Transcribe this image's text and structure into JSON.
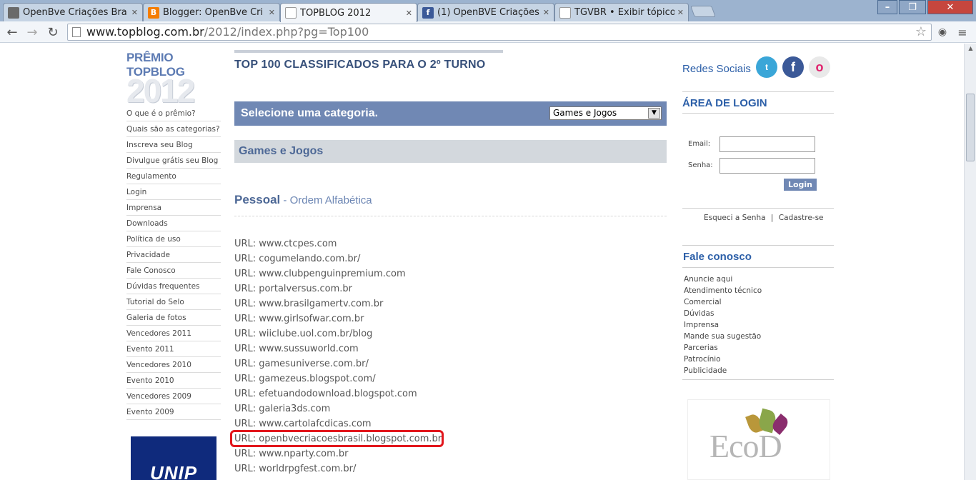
{
  "browser": {
    "tabs": [
      {
        "label": "OpenBve Criações Bra",
        "icon": "openbve-favicon-icon"
      },
      {
        "label": "Blogger: OpenBve Cri",
        "icon": "blogger-favicon-icon"
      },
      {
        "label": "TOPBLOG 2012",
        "icon": "page-icon"
      },
      {
        "label": "(1) OpenBVE Criações",
        "icon": "facebook-favicon-icon"
      },
      {
        "label": "TGVBR • Exibir tópico",
        "icon": "page-icon"
      }
    ],
    "url_host": "www.topblog.com.br",
    "url_path": "/2012/index.php?pg=Top100"
  },
  "logo": {
    "line1": "PRÊMIO TOPBLOG",
    "line2": "2012"
  },
  "left_nav": [
    "O que é o prêmio?",
    "Quais são as categorias?",
    "Inscreva seu Blog",
    "Divulgue grátis seu Blog",
    "Regulamento",
    "Login",
    "Imprensa",
    "Downloads",
    "Política de uso",
    "Privacidade",
    "Fale Conosco",
    "Dúvidas frequentes",
    "Tutorial do Selo",
    "Galeria de fotos",
    "Vencedores 2011",
    "Evento 2011",
    "Vencedores 2010",
    "Evento 2010",
    "Vencedores 2009",
    "Evento 2009"
  ],
  "sponsor_left": "UNIP",
  "main": {
    "title": "TOP 100 CLASSIFICADOS PARA O 2º TURNO",
    "category_prompt": "Selecione uma categoria.",
    "category_selected": "Games e Jogos",
    "category_heading": "Games e Jogos",
    "section_title": "Pessoal",
    "section_subtitle": " - Ordem Alfabética",
    "urls": [
      "URL: www.ctcpes.com",
      "URL: cogumelando.com.br/",
      "URL: www.clubpenguinpremium.com",
      "URL: portalversus.com.br",
      "URL: www.brasilgamertv.com.br",
      "URL: www.girlsofwar.com.br",
      "URL: wiiclube.uol.com.br/blog",
      "URL: www.sussuworld.com",
      "URL: gamesuniverse.com.br/",
      "URL: gamezeus.blogspot.com/",
      "URL: efetuandodownload.blogspot.com",
      "URL: galeria3ds.com",
      "URL: www.cartolafcdicas.com",
      "URL: openbvecriacoesbrasil.blogspot.com.br",
      "URL: www.nparty.com.br",
      "URL: worldrpgfest.com.br/"
    ],
    "highlight_color": "#e2161c"
  },
  "right": {
    "social_label": "Redes Sociais",
    "login_heading": "ÁREA DE LOGIN",
    "email_label": "Email:",
    "password_label": "Senha:",
    "login_button": "Login",
    "forgot_password": "Esqueci a Senha",
    "separator": "|",
    "register": "Cadastre-se",
    "contact_heading": "Fale conosco",
    "contact_links": [
      "Anuncie aqui",
      "Atendimento técnico",
      "Comercial",
      "Dúvidas",
      "Imprensa",
      "Mande sua sugestão",
      "Parcerias",
      "Patrocínio",
      "Publicidade"
    ],
    "sponsor_logo": "EcoD"
  },
  "colors": {
    "accent_blue": "#2c5fa8",
    "category_bar": "#7088b4",
    "title_navy": "#37507a"
  }
}
